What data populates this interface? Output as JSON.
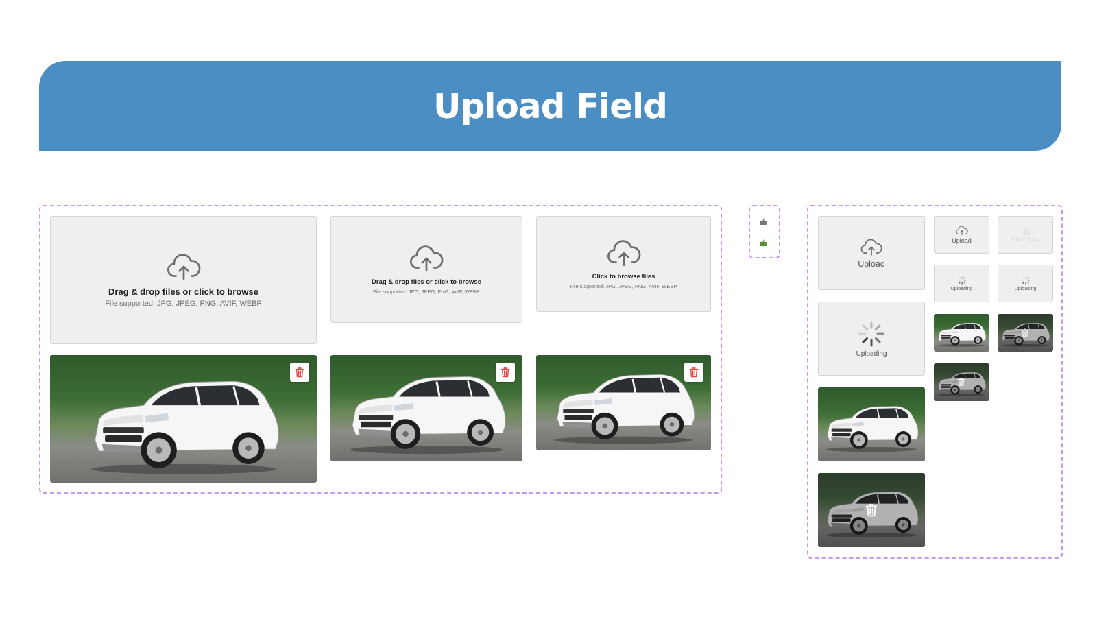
{
  "header": {
    "title": "Upload Field"
  },
  "colors": {
    "banner": "#4a8ec4",
    "dashed_border": "#c79af0",
    "delete_red": "#e04848",
    "like_green": "#5a8f35",
    "like_gray": "#777777"
  },
  "dropzones": {
    "large": {
      "title": "Drag & drop files or click to browse",
      "sub": "File supported: JPG, JPEG, PNG, AVIF, WEBP"
    },
    "medium": {
      "title": "Drag & drop files or click to browse",
      "sub": "File supported: JPG, JPEG, PNG, AVIF, WEBP"
    },
    "small": {
      "title": "Click to browse files",
      "sub": "File supported: JPG, JPEG, PNG, AVIF, WEBP"
    }
  },
  "compact": {
    "upload_label": "Upload",
    "uploading_label": "Uploading",
    "mini_upload_label": "Upload",
    "take_picture_label": "Take Pictures",
    "mini_uploading_label_1": "Uploading",
    "mini_uploading_label_2": "Uploading"
  },
  "icons": {
    "upload": "cloud-upload-icon",
    "delete": "trash-icon",
    "spinner": "spinner-icon",
    "camera": "camera-icon",
    "like": "thumbs-up-icon"
  }
}
